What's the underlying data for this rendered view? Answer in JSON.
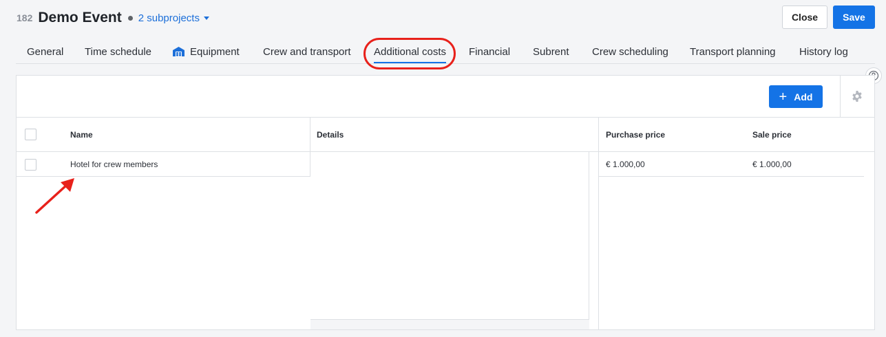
{
  "header": {
    "project_id": "182",
    "title": "Demo Event",
    "subprojects": "2 subprojects"
  },
  "actions": {
    "close_label": "Close",
    "save_label": "Save"
  },
  "tabs": [
    {
      "label": "General"
    },
    {
      "label": "Time schedule"
    },
    {
      "label": "Equipment",
      "icon": "warehouse-icon"
    },
    {
      "label": "Crew and transport"
    },
    {
      "label": "Additional costs",
      "active": true
    },
    {
      "label": "Financial"
    },
    {
      "label": "Subrent"
    },
    {
      "label": "Crew scheduling"
    },
    {
      "label": "Transport planning"
    },
    {
      "label": "History log"
    }
  ],
  "toolbar": {
    "add_label": "Add"
  },
  "table": {
    "columns": {
      "name": "Name",
      "details": "Details",
      "purchase_price": "Purchase price",
      "sale_price": "Sale price"
    },
    "rows": [
      {
        "name": "Hotel for crew members",
        "details": "",
        "purchase_price": "€ 1.000,00",
        "sale_price": "€ 1.000,00"
      }
    ]
  },
  "colors": {
    "accent": "#1473e6",
    "highlight": "#e8211b"
  }
}
